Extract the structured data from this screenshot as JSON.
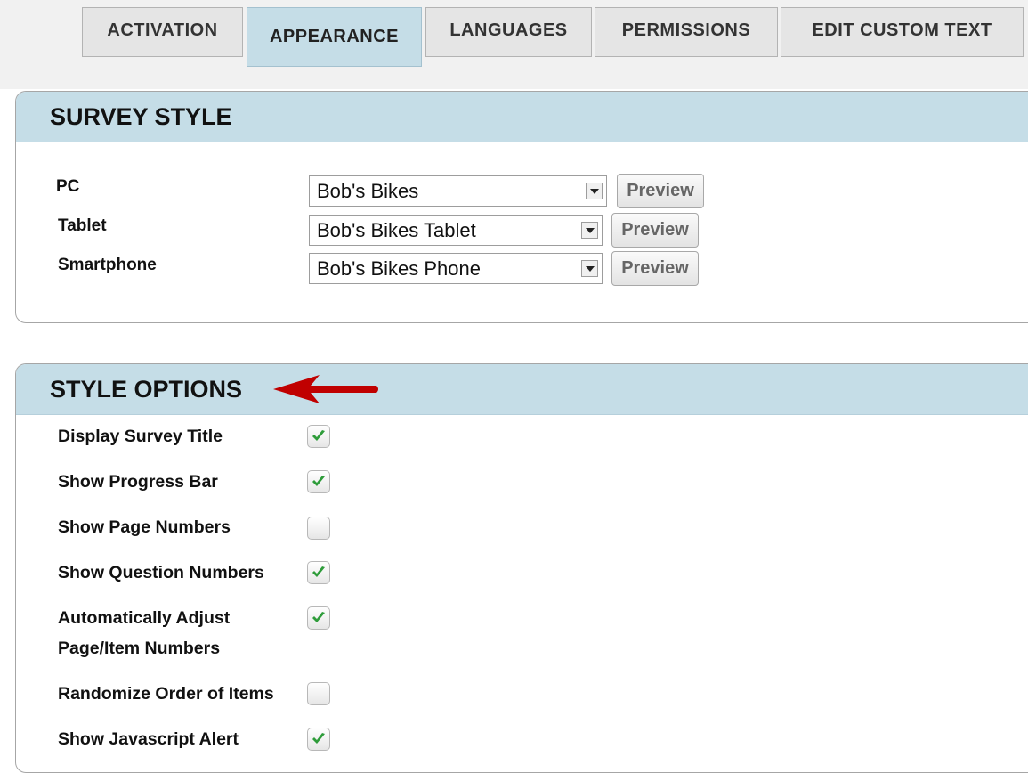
{
  "tabs": [
    {
      "label": "ACTIVATION",
      "active": false
    },
    {
      "label": "APPEARANCE",
      "active": true
    },
    {
      "label": "LANGUAGES",
      "active": false
    },
    {
      "label": "PERMISSIONS",
      "active": false
    },
    {
      "label": "EDIT CUSTOM TEXT",
      "active": false
    }
  ],
  "survey_style": {
    "title": "SURVEY STYLE",
    "rows": [
      {
        "label": "PC",
        "value": "Bob's Bikes",
        "button": "Preview"
      },
      {
        "label": "Tablet",
        "value": "Bob's Bikes Tablet",
        "button": "Preview"
      },
      {
        "label": "Smartphone",
        "value": "Bob's Bikes Phone",
        "button": "Preview"
      }
    ]
  },
  "style_options": {
    "title": "STYLE OPTIONS",
    "items": [
      {
        "label": "Display Survey Title",
        "checked": true
      },
      {
        "label": "Show Progress Bar",
        "checked": true
      },
      {
        "label": "Show Page Numbers",
        "checked": false
      },
      {
        "label": "Show Question Numbers",
        "checked": true
      },
      {
        "label": "Automatically Adjust",
        "label2": "Page/Item Numbers",
        "checked": true
      },
      {
        "label": "Randomize Order of Items",
        "checked": false
      },
      {
        "label": "Show Javascript Alert",
        "checked": true
      }
    ]
  },
  "colors": {
    "header_bg": "#c5dde7",
    "arrow": "#c00000",
    "check": "#2e9c3a"
  }
}
